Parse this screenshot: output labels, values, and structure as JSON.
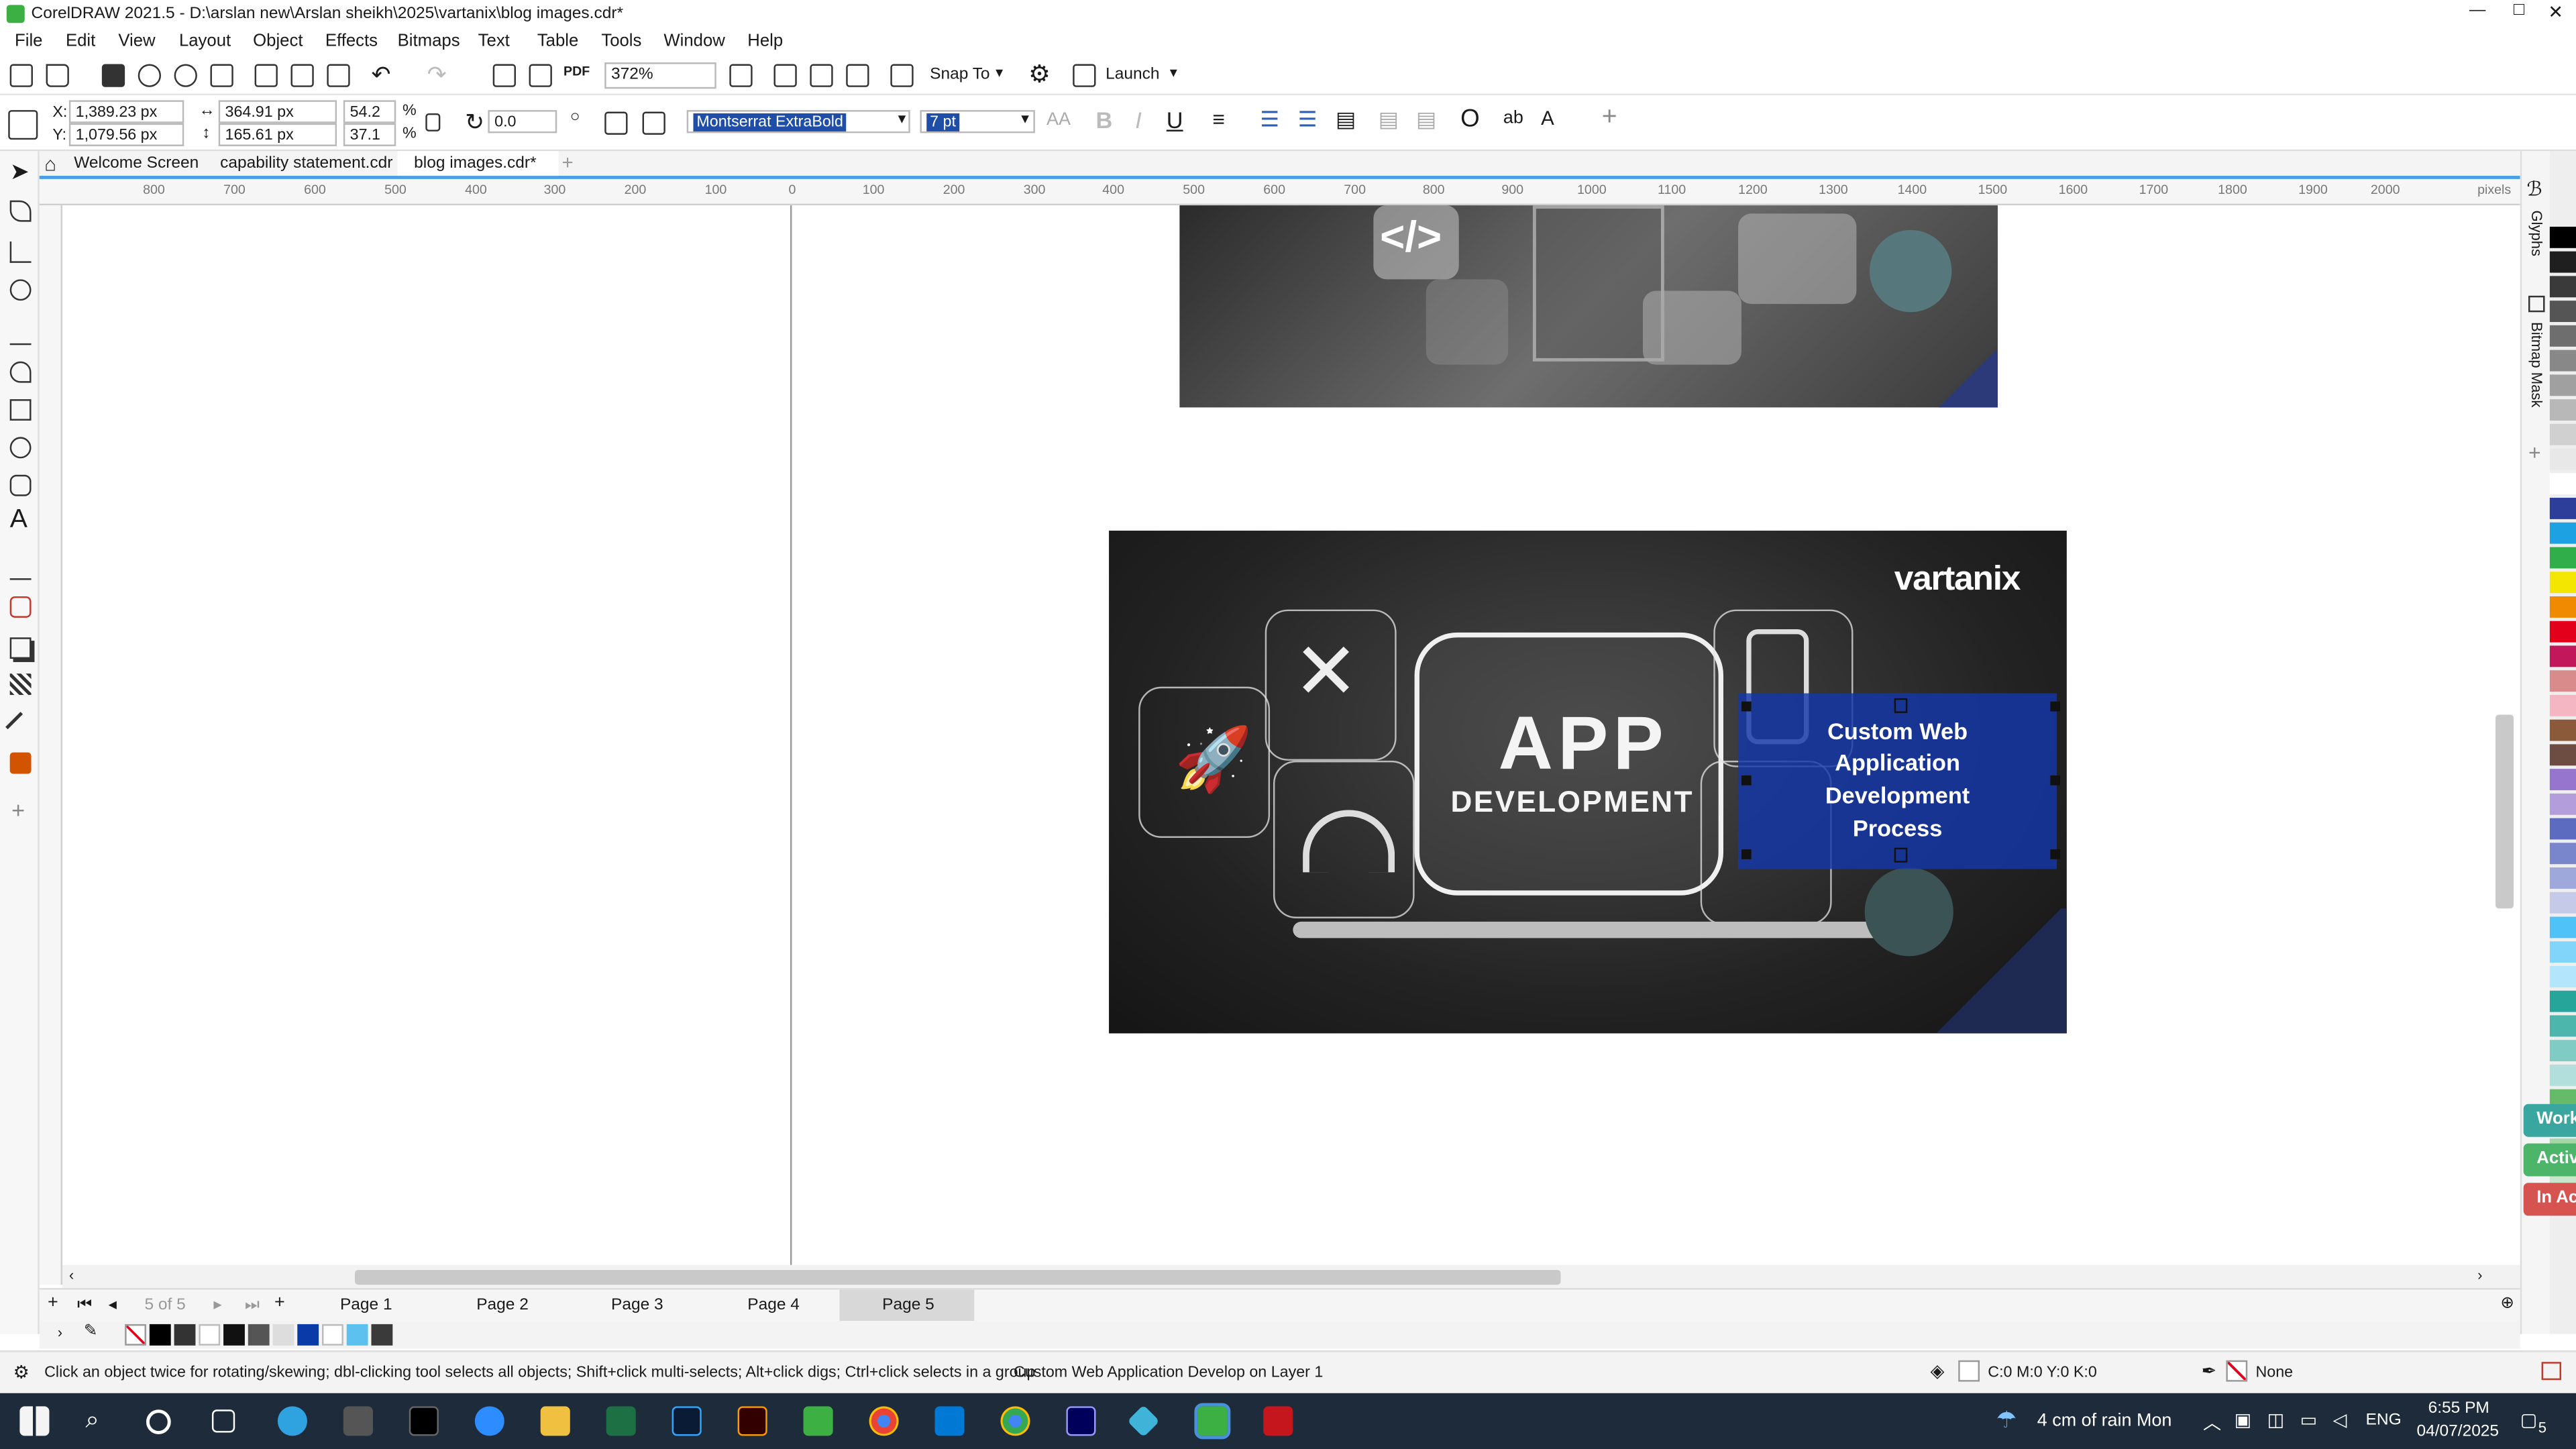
{
  "window": {
    "title": "CorelDRAW 2021.5 - D:\\arslan new\\Arslan sheikh\\2025\\vartanix\\blog images.cdr*",
    "minimize": "—",
    "maximize": "□",
    "close": "✕"
  },
  "menu": [
    "File",
    "Edit",
    "View",
    "Layout",
    "Object",
    "Effects",
    "Bitmaps",
    "Text",
    "Table",
    "Tools",
    "Window",
    "Help"
  ],
  "toolbar": {
    "zoom": "372%",
    "snap_label": "Snap To",
    "launch_label": "Launch"
  },
  "props": {
    "x_label": "X:",
    "x": "1,389.23 px",
    "y_label": "Y:",
    "y": "1,079.56 px",
    "w": "364.91 px",
    "h": "165.61 px",
    "sx": "54.2",
    "sy": "37.1",
    "pct": "%",
    "rotation": "0.0",
    "font_family": "Montserrat ExtraBold",
    "font_size": "7 pt"
  },
  "tabs": [
    "Welcome Screen",
    "capability statement.cdr",
    "blog images.cdr*"
  ],
  "ruler": {
    "h": [
      "800",
      "700",
      "600",
      "500",
      "400",
      "300",
      "200",
      "100",
      "0",
      "100",
      "200",
      "300",
      "400",
      "500",
      "600",
      "700",
      "800",
      "900",
      "1000",
      "1100",
      "1200",
      "1300",
      "1400",
      "1500",
      "1600",
      "1700",
      "1800",
      "1900",
      "2000"
    ],
    "unit": "pixels"
  },
  "canvas": {
    "brand": "vartanix",
    "app_title": "APP",
    "app_sub": "DEVELOPMENT",
    "selected_text": [
      "Custom Web",
      "Application",
      "Development",
      "Process"
    ],
    "code_glyph": "</>"
  },
  "pages": {
    "count": "5 of 5",
    "list": [
      "Page 1",
      "Page 2",
      "Page 3",
      "Page 4",
      "Page 5"
    ],
    "active_index": 4
  },
  "status": {
    "hint": "Click an object twice for rotating/skewing; dbl-clicking tool selects all objects; Shift+click multi-selects; Alt+click digs; Ctrl+click selects in a group",
    "object": "Custom Web Application Develop on Layer 1",
    "fill": "C:0 M:0 Y:0 K:0",
    "outline": "None"
  },
  "docker_tabs": [
    "Glyphs",
    "Bitmap Mask"
  ],
  "side_buttons": [
    {
      "label": "Work",
      "color": "#3aa6a0"
    },
    {
      "label": "Activ",
      "color": "#4cb56a"
    },
    {
      "label": "In Ac",
      "color": "#d6534f"
    }
  ],
  "palette_colors": [
    "#000000",
    "#1f1f1f",
    "#3a3a3a",
    "#555555",
    "#6e6e6e",
    "#888888",
    "#a0a0a0",
    "#b8b8b8",
    "#d0d0d0",
    "#e8e8e8",
    "#ffffff",
    "#2c3e9a",
    "#1da1e3",
    "#2fae4a",
    "#f3e600",
    "#f08a00",
    "#e3001b",
    "#c2185b",
    "#d98a8a",
    "#f4b6c2",
    "#8a5a3a",
    "#6d4c41",
    "#9575cd",
    "#b39ddb",
    "#5c6bc0",
    "#7986cb",
    "#9fa8da",
    "#c5cae9",
    "#4fc3f7",
    "#81d4fa",
    "#b3e5fc",
    "#26a69a",
    "#4db6ac",
    "#80cbc4",
    "#b2dfdb",
    "#66bb6a",
    "#81c784",
    "#a5d6a7",
    "#c8e6c9"
  ],
  "taskbar": {
    "weather": "4 cm of rain Mon",
    "lang": "ENG",
    "time": "6:55 PM",
    "date": "04/07/2025",
    "notif": "5"
  }
}
